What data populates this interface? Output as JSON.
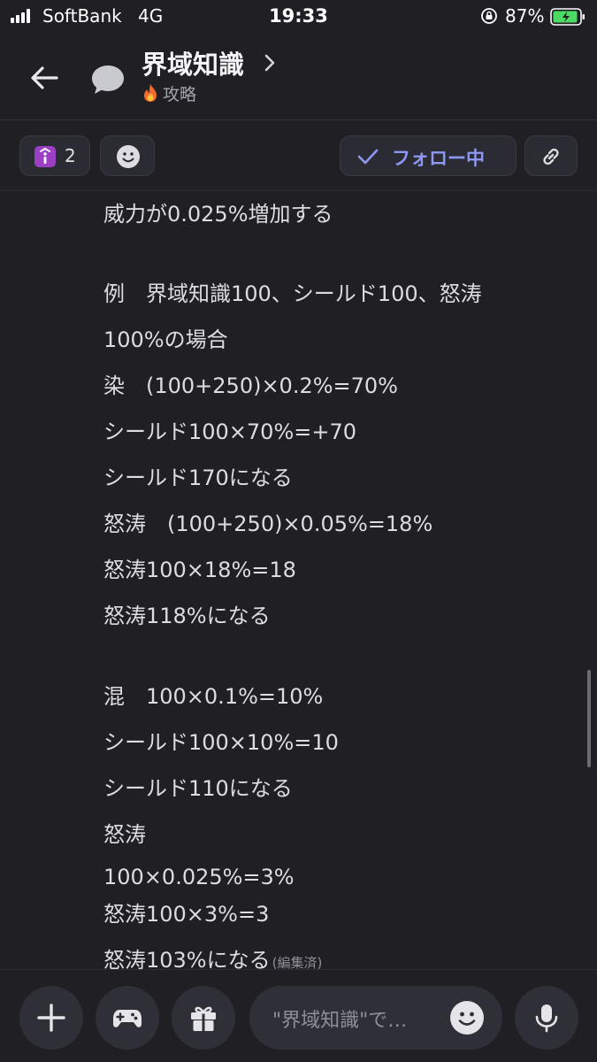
{
  "status": {
    "carrier": "SoftBank",
    "network": "4G",
    "time": "19:33",
    "battery": "87%"
  },
  "header": {
    "title": "界域知識",
    "subtitle": "攻略"
  },
  "toolbar": {
    "count": "2",
    "follow_label": "フォロー中"
  },
  "message": {
    "lines": [
      "威力が0.025%増加する",
      "例　界域知識100、シールド100、怒涛",
      "100%の場合",
      "染　(100+250)×0.2%=70%",
      "シールド100×70%=+70",
      "シールド170になる",
      "怒涛　(100+250)×0.05%=18%",
      "怒涛100×18%=18",
      "怒涛118%になる",
      "混　100×0.1%=10%",
      "シールド100×10%=10",
      "シールド110になる",
      "怒涛",
      "100×0.025%=3%",
      "怒涛100×3%=3",
      "怒涛103%になる"
    ],
    "edited_label": "(編集済)"
  },
  "composer": {
    "placeholder": "\"界域知識\"で…"
  },
  "colors": {
    "background": "#1f1f24",
    "accent": "#8e98f2",
    "battery_green": "#4cd964"
  },
  "icons": [
    "signal-icon",
    "lock-rotation-icon",
    "battery-icon",
    "back-arrow-icon",
    "chat-bubble-icon",
    "chevron-right-icon",
    "fire-icon",
    "info-badge-icon",
    "smiley-icon",
    "check-icon",
    "link-icon",
    "plus-icon",
    "gamepad-icon",
    "gift-icon",
    "microphone-icon"
  ]
}
